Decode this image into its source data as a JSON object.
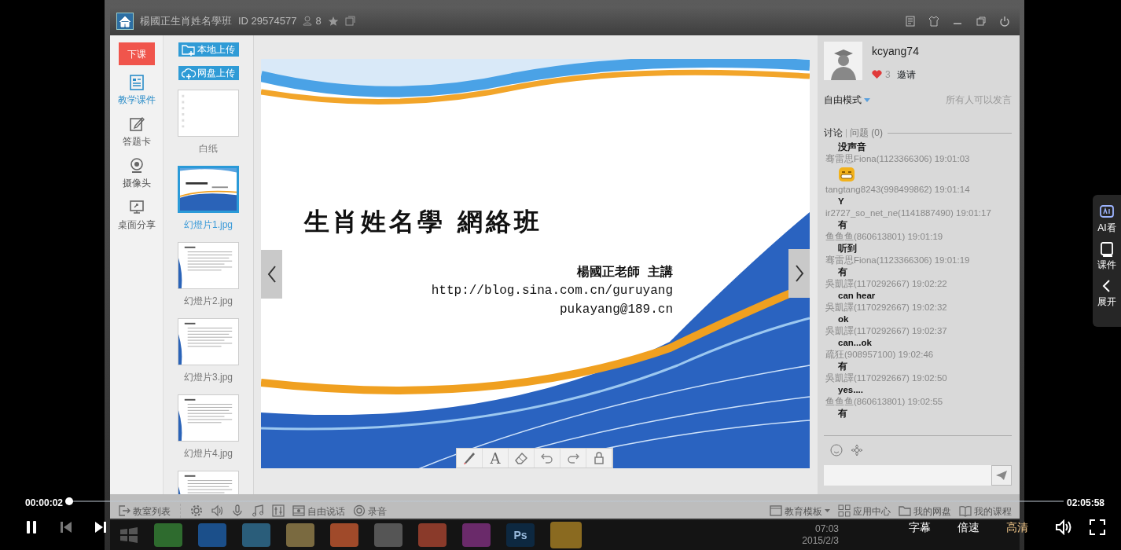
{
  "player": {
    "elapsed": "00:00:02",
    "duration": "02:05:58",
    "level": 0.0003,
    "buttons": [
      {
        "label": "字幕",
        "selected": false
      },
      {
        "label": "倍速",
        "selected": false
      },
      {
        "label": "高清",
        "selected": true
      }
    ]
  },
  "side_panel": [
    {
      "kind": "ai",
      "label": "AI看"
    },
    {
      "kind": "courseware",
      "label": "课件"
    },
    {
      "kind": "expand",
      "label": "展开"
    }
  ],
  "app": {
    "title": "楊國正生肖姓名學班",
    "room_id": "ID 29574577",
    "member_count": "8"
  },
  "nav": {
    "end_class": "下课",
    "items": [
      {
        "kind": "courseware",
        "label": "教学课件",
        "selected": true
      },
      {
        "kind": "answer",
        "label": "答题卡",
        "selected": false
      },
      {
        "kind": "camera",
        "label": "摄像头",
        "selected": false
      },
      {
        "kind": "screen",
        "label": "桌面分享",
        "selected": false
      }
    ]
  },
  "uploads": [
    {
      "kind": "folder",
      "label": "本地上传"
    },
    {
      "kind": "cloud",
      "label": "网盘上传"
    }
  ],
  "slides": [
    {
      "kind": "blank",
      "label": "白纸",
      "selected": false
    },
    {
      "kind": "title",
      "label": "幻燈片1.jpg",
      "selected": true
    },
    {
      "kind": "text",
      "label": "幻燈片2.jpg",
      "selected": false
    },
    {
      "kind": "text",
      "label": "幻燈片3.jpg",
      "selected": false
    },
    {
      "kind": "text",
      "label": "幻燈片4.jpg",
      "selected": false
    },
    {
      "kind": "text",
      "selected": false
    }
  ],
  "slide": {
    "title": "生肖姓名學 網絡班",
    "presenter": "楊國正老師 主講",
    "url": "http://blog.sina.com.cn/guruyang",
    "email": "pukayang@189.cn"
  },
  "draw_tools": [
    {
      "kind": "pen"
    },
    {
      "kind": "text",
      "glyph": "A"
    },
    {
      "kind": "eraser"
    },
    {
      "kind": "undo"
    },
    {
      "kind": "redo"
    },
    {
      "kind": "lock"
    }
  ],
  "profile": {
    "name": "kcyang74",
    "likes": "3",
    "invite": "邀请",
    "mode": "自由模式",
    "mode_note": "所有人可以发言"
  },
  "chat_tabs": [
    {
      "label": "讨论",
      "selected": true
    },
    {
      "label": "问题",
      "count": "(0)",
      "selected": false
    }
  ],
  "messages": [
    {
      "kind": "text",
      "text": "没声音"
    },
    {
      "kind": "emoji",
      "meta": "骞雷思Fiona(1123366306) 19:01:03"
    },
    {
      "kind": "text",
      "meta": "tangtang8243(998499862) 19:01:14",
      "text": "Y"
    },
    {
      "kind": "text",
      "meta": "ir2727_so_net_ne(1141887490) 19:01:17",
      "text": "有"
    },
    {
      "kind": "text",
      "meta": "鱼鱼鱼(860613801) 19:01:19",
      "text": "听到"
    },
    {
      "kind": "text",
      "meta": "骞雷思Fiona(1123366306) 19:01:19",
      "text": "有"
    },
    {
      "kind": "text",
      "meta": "吳凱譯(1170292667) 19:02:22",
      "text": "can hear"
    },
    {
      "kind": "text",
      "meta": "吳凱譯(1170292667) 19:02:32",
      "text": "ok"
    },
    {
      "kind": "text",
      "meta": "吳凱譯(1170292667) 19:02:37",
      "text": "can...ok"
    },
    {
      "kind": "text",
      "meta": "疏狂(908957100) 19:02:46",
      "text": "有"
    },
    {
      "kind": "text",
      "meta": "吳凱譯(1170292667) 19:02:50",
      "text": "yes...."
    },
    {
      "kind": "text",
      "meta": "鱼鱼鱼(860613801) 19:02:55",
      "text": "有"
    }
  ],
  "toolbar": {
    "left": [
      {
        "kind": "exit",
        "label": "教室列表"
      },
      {
        "kind": "gear"
      },
      {
        "kind": "speaker"
      },
      {
        "kind": "mic"
      },
      {
        "kind": "music"
      },
      {
        "kind": "mixer"
      },
      {
        "kind": "film",
        "label": "自由说话"
      },
      {
        "kind": "record",
        "label": "录音"
      }
    ],
    "right": [
      {
        "kind": "window",
        "label": "教育模板",
        "caret": true
      },
      {
        "kind": "apps",
        "label": "应用中心"
      },
      {
        "kind": "folder",
        "label": "我的网盘"
      },
      {
        "kind": "book",
        "label": "我的课程"
      }
    ]
  },
  "taskbar": {
    "ps_label": "Ps",
    "time": "07:03",
    "date": "2015/2/3"
  }
}
